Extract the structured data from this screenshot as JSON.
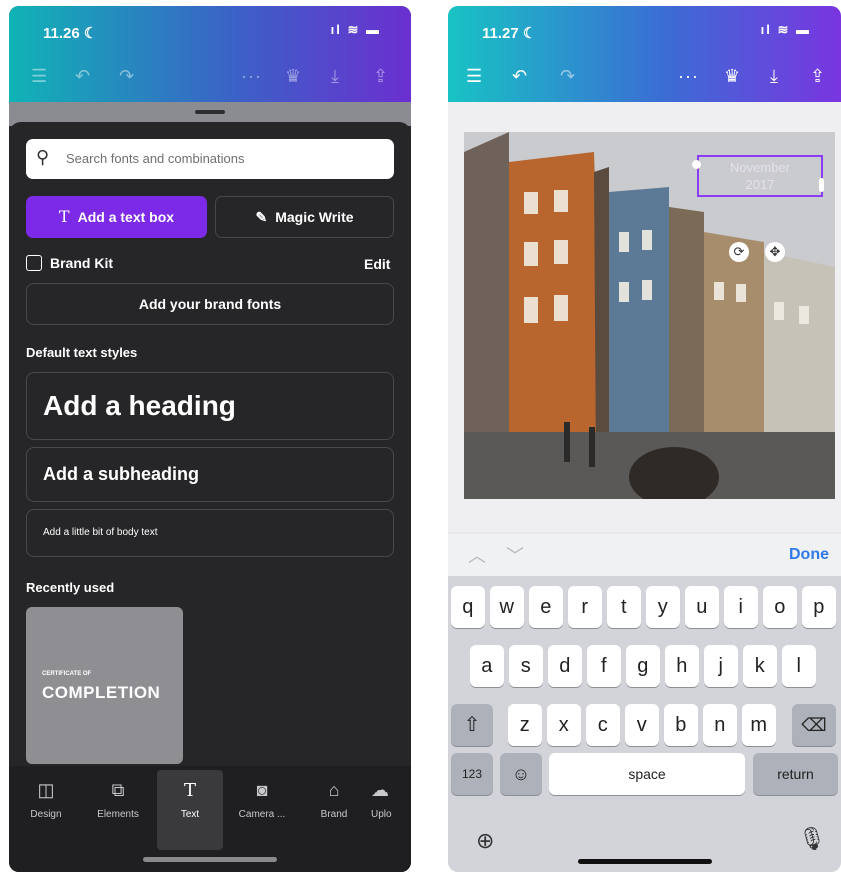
{
  "left_screen": {
    "status": {
      "time": "11.26 ☾",
      "indicators": "ıl ≋ ▬"
    },
    "toolbar": {
      "icons": [
        "menu-icon",
        "undo-icon",
        "redo-icon",
        "more-icon",
        "crown-icon",
        "download-icon",
        "share-icon"
      ]
    },
    "search": {
      "placeholder": "Search fonts and combinations"
    },
    "add_text_box": "Add a text box",
    "magic_write": "Magic Write",
    "brand_kit": {
      "label": "Brand Kit",
      "edit": "Edit"
    },
    "add_brand_fonts": "Add your brand fonts",
    "default_styles_title": "Default text styles",
    "styles": {
      "heading": "Add a heading",
      "subheading": "Add a subheading",
      "body": "Add a little bit of body text"
    },
    "recently_used_title": "Recently used",
    "recent_card": {
      "small": "CERTIFICATE OF",
      "big": "COMPLETION"
    },
    "nav": [
      {
        "label": "Design",
        "icon": "design-icon"
      },
      {
        "label": "Elements",
        "icon": "elements-icon"
      },
      {
        "label": "Text",
        "icon": "text-icon",
        "active": true
      },
      {
        "label": "Camera ...",
        "icon": "camera-icon"
      },
      {
        "label": "Brand",
        "icon": "brand-icon"
      },
      {
        "label": "Uplo",
        "icon": "upload-icon"
      }
    ]
  },
  "right_screen": {
    "status": {
      "time": "11.27 ☾",
      "indicators": "ıl ≋ ▬"
    },
    "text_box": {
      "line1": "November",
      "line2": "2017"
    },
    "kb_bar": {
      "done": "Done"
    },
    "keyboard": {
      "row1": [
        "q",
        "w",
        "e",
        "r",
        "t",
        "y",
        "u",
        "i",
        "o",
        "p"
      ],
      "row2": [
        "a",
        "s",
        "d",
        "f",
        "g",
        "h",
        "j",
        "k",
        "l"
      ],
      "row3": [
        "z",
        "x",
        "c",
        "v",
        "b",
        "n",
        "m"
      ],
      "numbers": "123",
      "space": "space",
      "return": "return"
    }
  }
}
